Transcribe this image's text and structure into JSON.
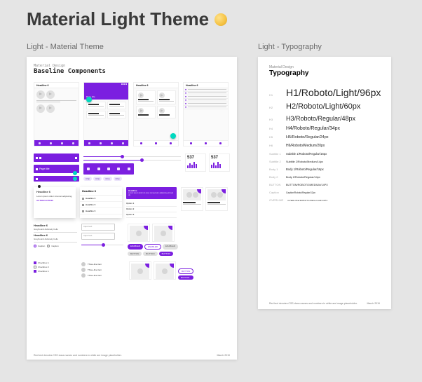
{
  "page": {
    "title": "Material Light Theme"
  },
  "leftPanel": {
    "label": "Light - Material Theme",
    "eyebrow": "Material Design",
    "heading": "Baseline Components",
    "mocks": {
      "headline": "Headline 6",
      "pageTitle": "Page title",
      "listItem": "Headline 6",
      "caption": "Caption"
    },
    "stats": {
      "a": "537",
      "b": "537"
    },
    "tooltip": {
      "title": "Headline 6",
      "body": "Lorem ipsum dolor sit amet adipiscing.",
      "actions": "ACTION  ACTION"
    },
    "menu": {
      "header": "Headline 6",
      "items": [
        "Headline 6",
        "Headline 6",
        "Headline 6"
      ]
    },
    "textcol": {
      "h": "Headline 6",
      "line": "Greyhound divisively hello",
      "cap": "Caption"
    },
    "banner": {
      "t": "Headline",
      "b": "Lorem ipsum dolor sit amet consectetur adipiscing elit sed do."
    },
    "options": [
      "Option 1",
      "Option 2",
      "Option 3",
      "Option 4"
    ],
    "buttons": {
      "enabled": "ENABLED",
      "button": "BUTTON"
    },
    "checks": [
      "Checkbox 1",
      "Checkbox 2"
    ],
    "avatars": [
      "Three-line item",
      "Three-line item",
      "Three-line item"
    ],
    "input": "Input text",
    "footerLeft": "Red text denotes CSS class names and numbers in white are image placeholder.",
    "footerRight": "March 2019"
  },
  "rightPanel": {
    "label": "Light - Typography",
    "eyebrow": "Material Design",
    "heading": "Typography",
    "scale": [
      {
        "label": "H1",
        "sample": "H1/Roboto/Light/96px",
        "cls": "s96"
      },
      {
        "label": "H2",
        "sample": "H2/Roboto/Light/60px",
        "cls": "s60"
      },
      {
        "label": "H3",
        "sample": "H3/Roboto/Regular/48px",
        "cls": "s48"
      },
      {
        "label": "H4",
        "sample": "H4/Roboto/Regular/34px",
        "cls": "s34"
      },
      {
        "label": "H5",
        "sample": "H5/Roboto/Regular/24px",
        "cls": "s24"
      },
      {
        "label": "H6",
        "sample": "H6/Roboto/Medium/20px",
        "cls": "s20"
      },
      {
        "label": "Subtitle 1",
        "sample": "Subtitle 1/Roboto/Regular/16px",
        "cls": "s16"
      },
      {
        "label": "Subtitle 2",
        "sample": "Subtitle 2/Roboto/Medium/14px",
        "cls": "s14m"
      },
      {
        "label": "Body 1",
        "sample": "Body 1/Roboto/Regular/16px",
        "cls": "s16"
      },
      {
        "label": "Body 2",
        "sample": "Body 2/Roboto/Regular/14px",
        "cls": "s14"
      },
      {
        "label": "BUTTON",
        "sample": "BUTTON/ROBOTO/MEDIUM/14PX",
        "cls": "s14m"
      },
      {
        "label": "Caption",
        "sample": "Caption/Roboto/Regular/12px",
        "cls": "s12"
      },
      {
        "label": "OVERLINE",
        "sample": "OVERLINE/ROBOTO/REGULAR/10PX",
        "cls": "s10"
      }
    ],
    "footerLeft": "Red text denotes CSS class names and numbers in white are image placeholder.",
    "footerRight": "March 2019"
  }
}
